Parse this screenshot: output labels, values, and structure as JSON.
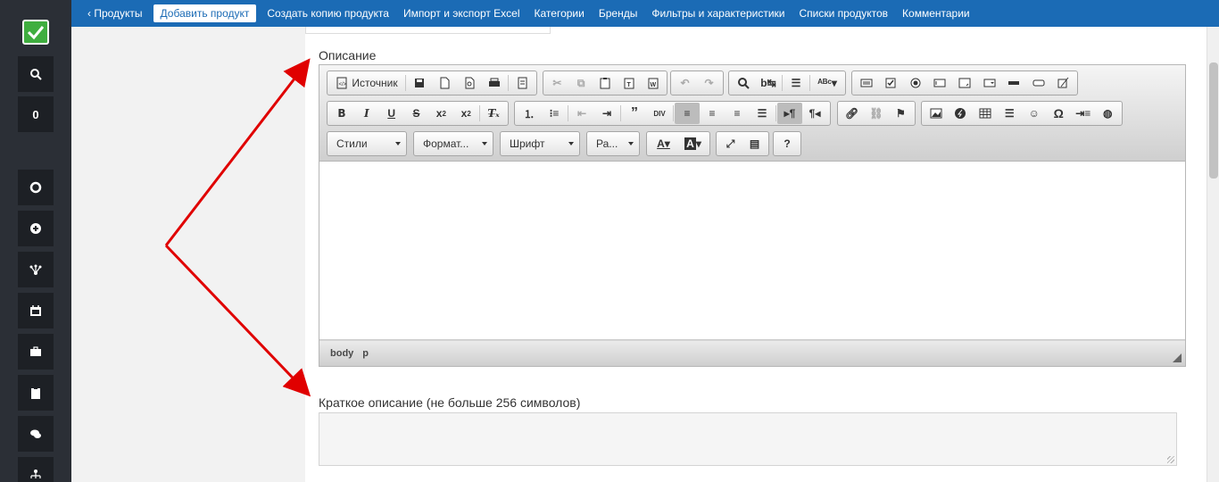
{
  "nav": {
    "items": [
      {
        "label": "‹ Продукты"
      },
      {
        "label": "Добавить продукт",
        "active": true
      },
      {
        "label": "Создать копию продукта"
      },
      {
        "label": "Импорт и экспорт Excel"
      },
      {
        "label": "Категории"
      },
      {
        "label": "Бренды"
      },
      {
        "label": "Фильтры и характеристики"
      },
      {
        "label": "Списки продуктов"
      },
      {
        "label": "Комментарии"
      }
    ]
  },
  "sidebar": {
    "counter": "0",
    "icons": [
      "search-icon",
      "lifebuoy-icon",
      "plus-circle-icon",
      "sitemap-icon",
      "calendar-icon",
      "briefcase-icon",
      "clipboard-icon",
      "comments-icon",
      "org-chart-icon"
    ]
  },
  "description": {
    "label": "Описание"
  },
  "editor": {
    "source_label": "Источник",
    "styles_label": "Стили",
    "format_label": "Формат...",
    "font_label": "Шрифт",
    "size_label": "Ра...",
    "statusbar": [
      "body",
      "p"
    ]
  },
  "short_description": {
    "label": "Краткое описание (не больше 256 символов)",
    "value": ""
  },
  "colors": {
    "nav": "#1b6bb5",
    "sidebar": "#2b2f36",
    "logo": "#3fae3f",
    "arrow": "#e00000"
  }
}
